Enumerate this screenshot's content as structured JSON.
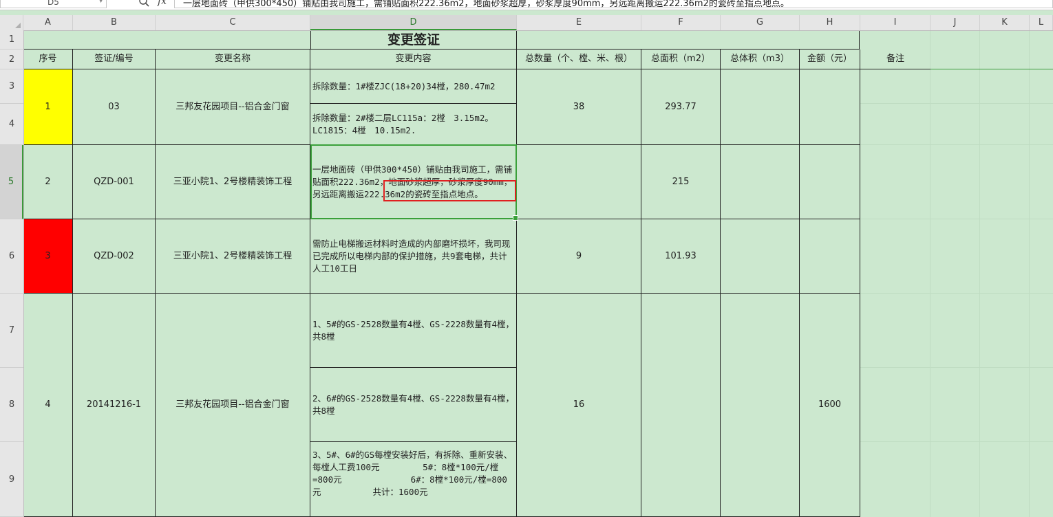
{
  "name_box": "D5",
  "formula_text": "一层地面砖（甲供300*450）铺贴由我司施工，需铺贴面积222.36m2，地面砂浆超厚，砂浆厚度90mm，另远距离搬运222.36m2的瓷砖至指点地点。",
  "columns": [
    "A",
    "B",
    "C",
    "D",
    "E",
    "F",
    "G",
    "H",
    "I",
    "J",
    "K",
    "L"
  ],
  "rows": [
    "1",
    "2",
    "3",
    "4",
    "5",
    "6",
    "7",
    "8",
    "9"
  ],
  "active_cell": {
    "col": "D",
    "row": "5"
  },
  "colors": {
    "sheet_bg": "#cce8cf",
    "yellow": "#ffff00",
    "red": "#ff0000",
    "selection": "#3aa03a",
    "highlight": "#e02020"
  },
  "title": "变更签证",
  "headers": {
    "seq": "序号",
    "code": "签证/编号",
    "name": "变更名称",
    "content": "变更内容",
    "qty": "总数量（个、樘、米、根）",
    "area": "总面积（m2）",
    "volume": "总体积（m3）",
    "amount": "金额（元）",
    "remark": "备注"
  },
  "records": {
    "r1": {
      "seq": "1",
      "code": "03",
      "name": "三邦友花园项目--铝合金门窗",
      "content_a": "拆除数量：1#楼ZJC(18+20)34樘，280.47m2",
      "content_b": "拆除数量：2#楼二层LC115a：2樘　3.15m2。LC1815：4樘　10.15m2.",
      "qty": "38",
      "area": "293.77"
    },
    "r2": {
      "seq": "2",
      "code": "QZD-001",
      "name": "三亚小院1、2号楼精装饰工程",
      "content": "一层地面砖（甲供300*450）铺贴由我司施工，需铺贴面积222.36m2，地面砂浆超厚，砂浆厚度90mm，另远距离搬运222.36m2的瓷砖至指点地点。",
      "area": "215"
    },
    "r3": {
      "seq": "3",
      "code": "QZD-002",
      "name": "三亚小院1、2号楼精装饰工程",
      "content": "需防止电梯搬运材料时造成的内部磨坏损坏，我司现已完成所以电梯内部的保护措施，共9套电梯，共计人工10工日",
      "qty": "9",
      "area": "101.93"
    },
    "r4": {
      "seq": "4",
      "code": "20141216-1",
      "name": "三邦友花园项目--铝合金门窗",
      "content_a": "1、5#的GS-2528数量有4樘、GS-2228数量有4樘，共8樘",
      "content_b": "2、6#的GS-2528数量有4樘、GS-2228数量有4樘，共8樘",
      "content_c": "3、5#、6#的GS每樘安装好后，有拆除、重新安装、每樘人工费100元　　　　　5#：8樘*100元/樘=800元　　　　　　　　6#：8樘*100元/樘=800元　　　　　　共计：1600元",
      "qty": "16",
      "amount": "1600"
    }
  }
}
